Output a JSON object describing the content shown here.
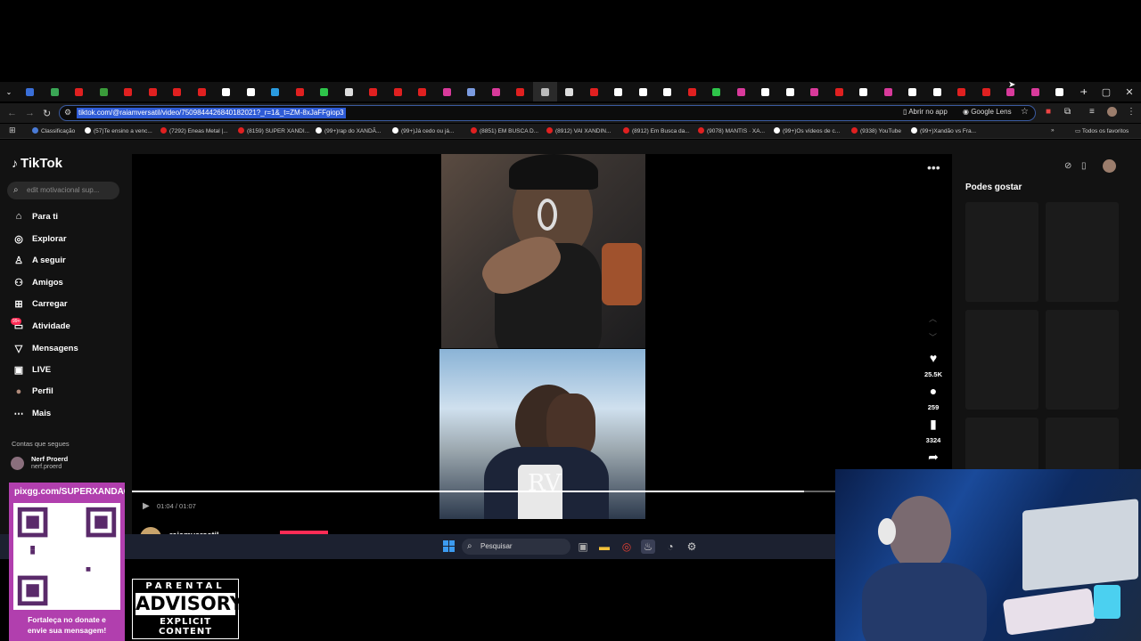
{
  "browser": {
    "url": "tiktok.com/@raiamversatil/video/7509844426840182021?_r=1&_t=ZM-8xJaFFgiop3",
    "omnibox_right": {
      "app_label": "Abrir no app",
      "lens_label": "Google Lens"
    },
    "bookmarks": [
      {
        "label": "Classificação",
        "color": "#4a7bd6"
      },
      {
        "label": "(57)Te ensino a venc...",
        "color": "#ffffff"
      },
      {
        "label": "(7292) Eneas Metal |...",
        "color": "#e02020"
      },
      {
        "label": "(8159) SUPER XANDI...",
        "color": "#e02020"
      },
      {
        "label": "(99+)rap do XANDÃ...",
        "color": "#ffffff"
      },
      {
        "label": "(99+)Já cedo ou já...",
        "color": "#ffffff"
      },
      {
        "label": "(8851) EM BUSCA D...",
        "color": "#e02020"
      },
      {
        "label": "(8912) VAI XANDIN...",
        "color": "#e02020"
      },
      {
        "label": "(8912) Em Busca da...",
        "color": "#e02020"
      },
      {
        "label": "(9078) MANTIS · XA...",
        "color": "#e02020"
      },
      {
        "label": "(99+)Os vídeos de c...",
        "color": "#ffffff"
      },
      {
        "label": "(9338) YouTube",
        "color": "#e02020"
      },
      {
        "label": "(99+)Xandão vs Fra...",
        "color": "#ffffff"
      }
    ],
    "all_bookmarks": "Todos os favoritos"
  },
  "tiktok": {
    "logo": "TikTok",
    "search_placeholder": "edit motivacional sup...",
    "nav": [
      {
        "label": "Para ti",
        "icon": "home-icon"
      },
      {
        "label": "Explorar",
        "icon": "compass-icon"
      },
      {
        "label": "A seguir",
        "icon": "following-icon"
      },
      {
        "label": "Amigos",
        "icon": "friends-icon"
      },
      {
        "label": "Carregar",
        "icon": "upload-icon"
      },
      {
        "label": "Atividade",
        "icon": "inbox-icon"
      },
      {
        "label": "Mensagens",
        "icon": "send-icon"
      },
      {
        "label": "LIVE",
        "icon": "live-icon"
      },
      {
        "label": "Perfil",
        "icon": "avatar"
      },
      {
        "label": "Mais",
        "icon": "more-icon"
      }
    ],
    "activity_badge": "99+",
    "following_header": "Contas que segues",
    "following": {
      "name": "Nerf Proerd",
      "user": "nerf.proerd"
    },
    "likes": "25.5K",
    "comments": "259",
    "saves": "3324",
    "time": "01:04 / 01:07",
    "progress": 0.955,
    "author": "raiamversatil",
    "watermark": "RV",
    "recommended_title": "Podes gostar"
  },
  "taskbar": {
    "search_label": "Pesquisar"
  },
  "overlay": {
    "qr_url": "pixgg.com/SUPERXANDAO",
    "qr_caption_1": "Fortaleça no donate e",
    "qr_caption_2": "envie sua mensagem!",
    "advisory_1": "PARENTAL",
    "advisory_2": "ADVISORY",
    "advisory_3": "EXPLICIT CONTENT"
  },
  "colors": {
    "accent": "#fe2c55",
    "qr_bg": "#b13fae",
    "url_selection": "#2e5bd6"
  }
}
